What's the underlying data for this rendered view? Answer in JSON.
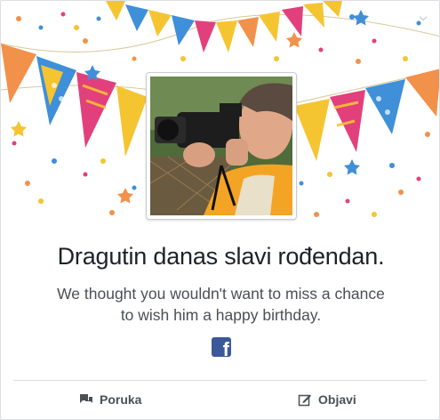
{
  "card": {
    "headline": "Dragutin danas slavi rođendan.",
    "subtext": "We thought you wouldn't want to miss a chance to wish him a happy birthday.",
    "brand_icon": "facebook-f-icon",
    "brand_glyph": "f",
    "menu_icon": "chevron-down-icon"
  },
  "actions": {
    "message_label": "Poruka",
    "message_icon": "chat-bubbles-icon",
    "post_label": "Objavi",
    "post_icon": "pencil-square-icon"
  },
  "colors": {
    "facebook_blue": "#3b5998",
    "bunting_yellow": "#f5c431",
    "bunting_blue": "#3f8fd9",
    "bunting_pink": "#e2407c",
    "bunting_orange": "#f2914a"
  }
}
